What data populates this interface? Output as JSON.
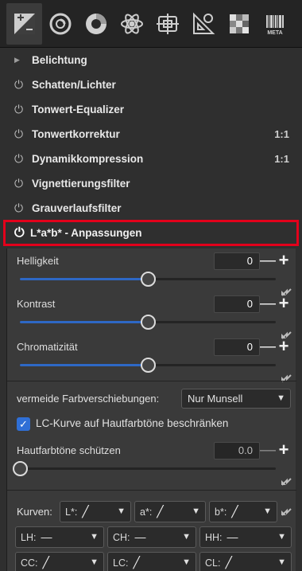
{
  "toolbar": {
    "tabs": [
      {
        "name": "exposure-tab-icon",
        "active": true
      },
      {
        "name": "detail-tab-icon"
      },
      {
        "name": "color-tab-icon"
      },
      {
        "name": "advanced-tab-icon"
      },
      {
        "name": "transform-tab-icon"
      },
      {
        "name": "raw-tab-icon"
      },
      {
        "name": "filmstrip-tab-icon"
      },
      {
        "name": "meta-tab-icon"
      }
    ],
    "meta_label": "META"
  },
  "tools": [
    {
      "label": "Belichtung",
      "expander": "triangle",
      "right": ""
    },
    {
      "label": "Schatten/Lichter",
      "expander": "power",
      "right": ""
    },
    {
      "label": "Tonwert-Equalizer",
      "expander": "power",
      "right": ""
    },
    {
      "label": "Tonwertkorrektur",
      "expander": "power",
      "right": "1:1"
    },
    {
      "label": "Dynamikkompression",
      "expander": "power",
      "right": "1:1"
    },
    {
      "label": "Vignettierungsfilter",
      "expander": "power",
      "right": ""
    },
    {
      "label": "Grauverlaufsfilter",
      "expander": "power",
      "right": ""
    }
  ],
  "lab": {
    "title": "L*a*b* - Anpassungen",
    "sliders": [
      {
        "label": "Helligkeit",
        "value": "0",
        "fraction": 0.5
      },
      {
        "label": "Kontrast",
        "value": "0",
        "fraction": 0.5
      },
      {
        "label": "Chromatizität",
        "value": "0",
        "fraction": 0.5
      }
    ],
    "avoid_shift_label": "vermeide Farbverschiebungen:",
    "avoid_shift_value": "Nur Munsell",
    "lc_checkbox_label": "LC-Kurve auf Hautfarbtöne beschränken",
    "lc_checked": true,
    "protect_label": "Hautfarbtöne schützen",
    "protect_value": "0.0",
    "protect_fraction": 0.0,
    "curves_label": "Kurven:",
    "curve_row1": [
      {
        "label": "L*:"
      },
      {
        "label": "a*:"
      },
      {
        "label": "b*:"
      }
    ],
    "curve_row2": [
      {
        "label": "LH:"
      },
      {
        "label": "CH:"
      },
      {
        "label": "HH:"
      }
    ],
    "curve_row3": [
      {
        "label": "CC:"
      },
      {
        "label": "LC:"
      },
      {
        "label": "CL:"
      }
    ]
  },
  "colors": {
    "accent": "#2e68c5",
    "highlight_border": "#e3001b"
  }
}
